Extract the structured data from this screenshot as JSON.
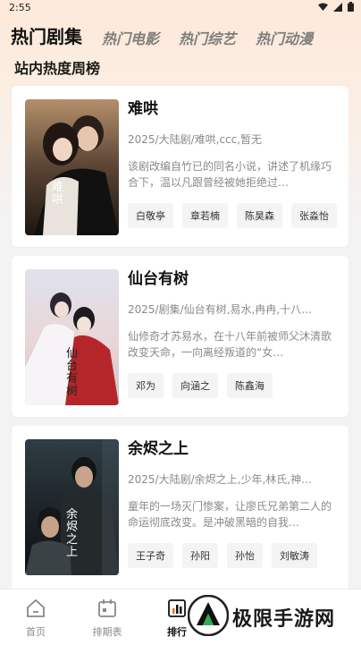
{
  "status_bar": {
    "time": "2:55",
    "wifi_icon": "wifi-icon",
    "signal_icon": "signal-icon",
    "battery_icon": "battery-icon"
  },
  "tabs": [
    {
      "label": "热门剧集",
      "active": true
    },
    {
      "label": "热门电影",
      "active": false
    },
    {
      "label": "热门综艺",
      "active": false
    },
    {
      "label": "热门动漫",
      "active": false
    }
  ],
  "section_title": "站内热度周榜",
  "cards": [
    {
      "title": "难哄",
      "meta": "2025/大陆剧/难哄,ccc,暂无",
      "desc": "该剧改编自竹已的同名小说，讲述了机缘巧合下，温以凡跟曾经被她拒绝过…",
      "tags": [
        "白敬亭",
        "章若楠",
        "陈昊森",
        "张淼怡"
      ],
      "poster_text": "难哄"
    },
    {
      "title": "仙台有树",
      "meta": "2025/剧集/仙台有树,易水,冉冉,十八…",
      "desc": "仙修奇才苏易水，在十八年前被师父沐清歌改变天命，一向离经叛道的“女…",
      "tags": [
        "邓为",
        "向涵之",
        "陈鑫海"
      ],
      "poster_text": "仙台有树"
    },
    {
      "title": "余烬之上",
      "meta": "2025/大陆剧/余烬之上,少年,林氏,神…",
      "desc": "童年的一场灭门惨案，让廖氏兄弟第二人的命运彻底改变。是冲破黑暗的自我…",
      "tags": [
        "王子奇",
        "孙阳",
        "孙怡",
        "刘敏涛"
      ],
      "poster_text": "余烬之上"
    }
  ],
  "bottom_nav": [
    {
      "label": "首页",
      "icon": "home-icon",
      "active": false
    },
    {
      "label": "排期表",
      "icon": "calendar-icon",
      "active": false
    },
    {
      "label": "排行",
      "icon": "ranking-icon",
      "active": true
    }
  ],
  "watermark": {
    "text": "极限手游网",
    "logo": "watermark-logo-icon"
  },
  "colors": {
    "accent": "#111111",
    "background": "#f3f3f4",
    "header_gradient": "#fde9d9"
  }
}
